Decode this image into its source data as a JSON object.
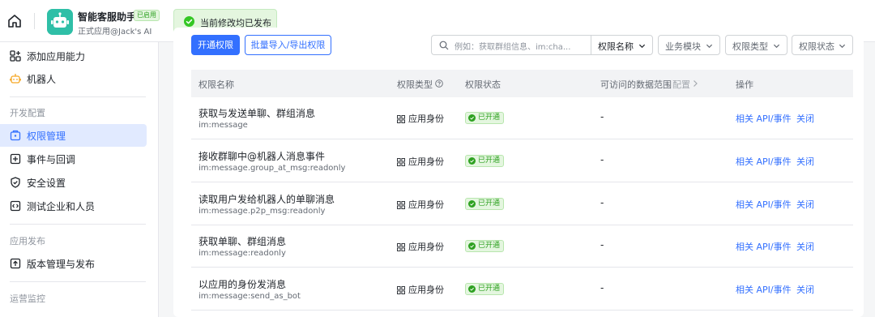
{
  "topbar": {
    "app_name": "智能客服助手",
    "app_badge": "已启用",
    "app_subtitle": "正式应用@Jack's AI",
    "toast_text": "当前修改均已发布"
  },
  "sidebar": {
    "items_top": [
      {
        "label": "添加应用能力",
        "icon": "add-capability-icon"
      },
      {
        "label": "机器人",
        "icon": "robot-icon"
      }
    ],
    "group_dev": "开发配置",
    "items_dev": [
      {
        "label": "权限管理",
        "icon": "permission-icon",
        "active": true
      },
      {
        "label": "事件与回调",
        "icon": "event-icon"
      },
      {
        "label": "安全设置",
        "icon": "shield-icon"
      },
      {
        "label": "测试企业和人员",
        "icon": "code-icon"
      }
    ],
    "group_release": "应用发布",
    "items_release": [
      {
        "label": "版本管理与发布",
        "icon": "upload-icon"
      }
    ],
    "group_ops": "运营监控"
  },
  "toolbar": {
    "enable_label": "开通权限",
    "bulk_label": "批量导入/导出权限",
    "search_placeholder": "例如：获取群组信息、im:cha...",
    "filter_name": "权限名称",
    "filter_module": "业务模块",
    "filter_type": "权限类型",
    "filter_status": "权限状态"
  },
  "table": {
    "columns": {
      "name": "权限名称",
      "type": "权限类型",
      "status": "权限状态",
      "scope": "可访问的数据范围",
      "scope_config": "配置",
      "actions": "操作"
    },
    "rows": [
      {
        "name": "获取与发送单聊、群组消息",
        "code": "im:message",
        "type": "应用身份",
        "status": "已开通",
        "scope": "-",
        "api": "相关 API/事件",
        "close": "关闭"
      },
      {
        "name": "接收群聊中@机器人消息事件",
        "code": "im:message.group_at_msg:readonly",
        "type": "应用身份",
        "status": "已开通",
        "scope": "-",
        "api": "相关 API/事件",
        "close": "关闭"
      },
      {
        "name": "读取用户发给机器人的单聊消息",
        "code": "im:message.p2p_msg:readonly",
        "type": "应用身份",
        "status": "已开通",
        "scope": "-",
        "api": "相关 API/事件",
        "close": "关闭"
      },
      {
        "name": "获取单聊、群组消息",
        "code": "im:message:readonly",
        "type": "应用身份",
        "status": "已开通",
        "scope": "-",
        "api": "相关 API/事件",
        "close": "关闭"
      },
      {
        "name": "以应用的身份发消息",
        "code": "im:message:send_as_bot",
        "type": "应用身份",
        "status": "已开通",
        "scope": "-",
        "api": "相关 API/事件",
        "close": "关闭"
      }
    ]
  },
  "colors": {
    "accent": "#3370ff",
    "success": "#2ea121",
    "app_icon": "#2fbfa7"
  }
}
